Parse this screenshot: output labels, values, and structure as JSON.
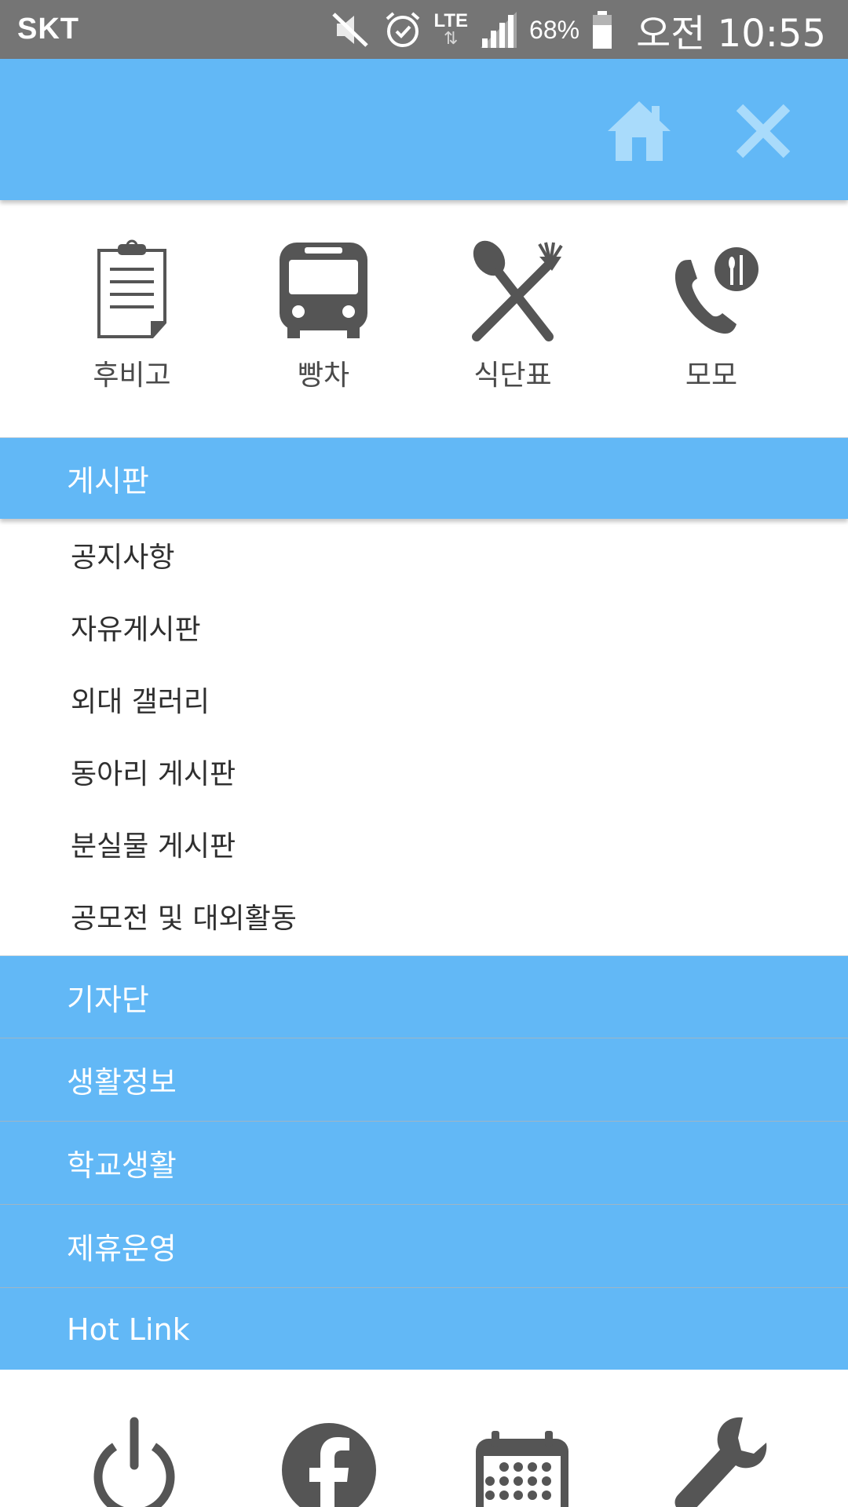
{
  "status_bar": {
    "carrier": "SKT",
    "network": "LTE",
    "battery": "68%",
    "time": "오전 10:55",
    "icons": [
      "mute-icon",
      "alarm-icon",
      "lte-icon",
      "signal-icon",
      "battery-icon"
    ]
  },
  "header": {
    "icons": [
      "home-icon",
      "close-icon"
    ],
    "color": "#62b8f6",
    "icon_color": "#a9dbfb"
  },
  "quick_links": [
    {
      "label": "후비고",
      "icon": "clipboard-icon"
    },
    {
      "label": "빵차",
      "icon": "bus-icon"
    },
    {
      "label": "식단표",
      "icon": "utensils-icon"
    },
    {
      "label": "모모",
      "icon": "phone-restaurant-icon"
    }
  ],
  "board": {
    "title": "게시판",
    "items": [
      "공지사항",
      "자유게시판",
      "외대 갤러리",
      "동아리 게시판",
      "분실물 게시판",
      "공모전 및 대외활동"
    ]
  },
  "sections": [
    "기자단",
    "생활정보",
    "학교생활",
    "제휴운영",
    "Hot Link"
  ],
  "bottom_icons": [
    "power-icon",
    "facebook-icon",
    "calendar-icon",
    "wrench-icon"
  ],
  "colors": {
    "accent": "#62b8f6",
    "icon_gray": "#555555",
    "status_bar": "#757575"
  }
}
